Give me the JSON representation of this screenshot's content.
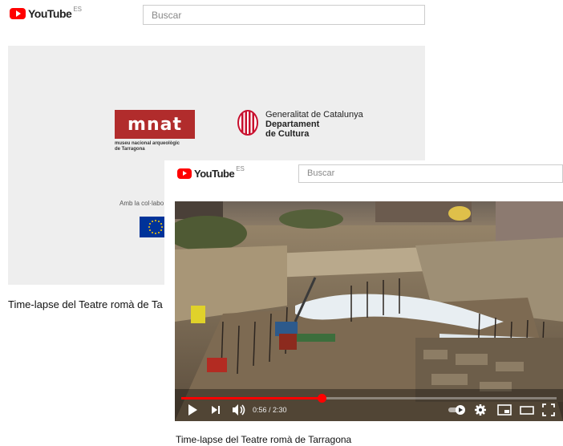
{
  "back_window": {
    "masthead": {
      "logo_text": "YouTube",
      "country_code": "ES",
      "search_placeholder": "Buscar"
    },
    "player": {
      "mnat_logo_text": "mnat",
      "mnat_subtitle_line1": "museu nacional arqueològic",
      "mnat_subtitle_line2": "de Tarragona",
      "gencat_line1": "Generalitat de Catalunya",
      "gencat_line2": "Departament",
      "gencat_line3": "de Cultura",
      "collab_text": "Amb la col·labo"
    },
    "video_title": "Time-lapse del Teatre romà de Ta"
  },
  "front_window": {
    "masthead": {
      "logo_text": "YouTube",
      "country_code": "ES",
      "search_placeholder": "Buscar"
    },
    "player": {
      "time_display": "0:56 / 2:30",
      "progress_fraction": 0.373
    },
    "video_title": "Time-lapse del Teatre romà de Tarragona"
  },
  "colors": {
    "youtube_red": "#ff0000",
    "mnat_red": "#b12c2c",
    "eu_blue": "#003399"
  },
  "icons": {
    "play": "play-icon",
    "next": "next-icon",
    "volume": "volume-icon",
    "autoplay": "autoplay-toggle-icon",
    "settings": "gear-icon",
    "miniplayer": "miniplayer-icon",
    "theater": "theater-mode-icon",
    "fullscreen": "fullscreen-icon"
  }
}
